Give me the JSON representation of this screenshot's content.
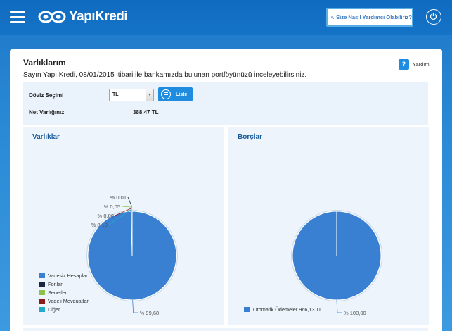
{
  "header": {
    "brand": "YapıKredi",
    "help_search_label": "Size Nasıl Yardımcı Olabiliriz?"
  },
  "page": {
    "title": "Varlıklarım",
    "description": "Sayın Yapı Kredi, 08/01/2015 itibari ile bankamızda bulunan portföyünüzü inceleyebilirsiniz.",
    "help_label": "Yardım",
    "help_icon_glyph": "?"
  },
  "filters": {
    "currency_label": "Döviz Seçimi",
    "currency_value": "TL",
    "list_button_label": "Liste",
    "net_worth_label": "Net Varlığınız",
    "net_worth_value": "388,47 TL"
  },
  "chart_data": [
    {
      "type": "pie",
      "title": "Varlıklar",
      "slices": [
        {
          "label": "Vadesiz Hesaplar",
          "value": 99.68,
          "display": "% 99,68",
          "color": "#3a80d2"
        },
        {
          "label": "Fonlar",
          "value": 0.01,
          "display": "% 0,01",
          "color": "#1a2740"
        },
        {
          "label": "Senetler",
          "value": 0.05,
          "display": "% 0,05",
          "color": "#8bc34a"
        },
        {
          "label": "Vadeli Mevduatlar",
          "value": 0.08,
          "display": "% 0,08",
          "color": "#8b1a1a"
        },
        {
          "label": "Diğer",
          "value": 0.19,
          "display": "% 0,19",
          "color": "#22aacc"
        }
      ],
      "legend_placement": "bottom-left"
    },
    {
      "type": "pie",
      "title": "Borçlar",
      "slices": [
        {
          "label": "Otomatik Ödemeler 966,13 TL",
          "value": 100.0,
          "display": "% 100,00",
          "color": "#3a80d2"
        }
      ],
      "legend_placement": "bottom-left"
    }
  ]
}
